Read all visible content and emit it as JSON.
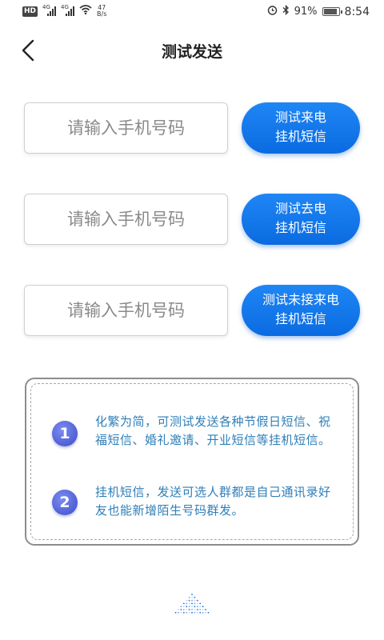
{
  "status_bar": {
    "hd_badge": "HD",
    "signal_tag_1": "4G",
    "signal_tag_2": "4G",
    "speed_value": "47",
    "speed_unit": "B/s",
    "battery_percent": "91%",
    "time": "8:54"
  },
  "nav": {
    "title": "测试发送",
    "back_icon": "chevron-left-icon"
  },
  "rows": [
    {
      "placeholder": "请输入手机号码",
      "button_line1": "测试来电",
      "button_line2": "挂机短信"
    },
    {
      "placeholder": "请输入手机号码",
      "button_line1": "测试去电",
      "button_line2": "挂机短信"
    },
    {
      "placeholder": "请输入手机号码",
      "button_line1": "测试未接来电",
      "button_line2": "挂机短信"
    }
  ],
  "info": {
    "items": [
      {
        "number": "1",
        "text": "化繁为简，可测试发送各种节假日短信、祝福短信、婚礼邀请、开业短信等挂机短信。"
      },
      {
        "number": "2",
        "text": "挂机短信，发送可选人群都是自己通讯录好友也能新增陌生号码群发。"
      }
    ]
  },
  "colors": {
    "button_blue": "#0a6be0",
    "info_text": "#2f7fb8",
    "number_circle": "#4f5fd6"
  }
}
